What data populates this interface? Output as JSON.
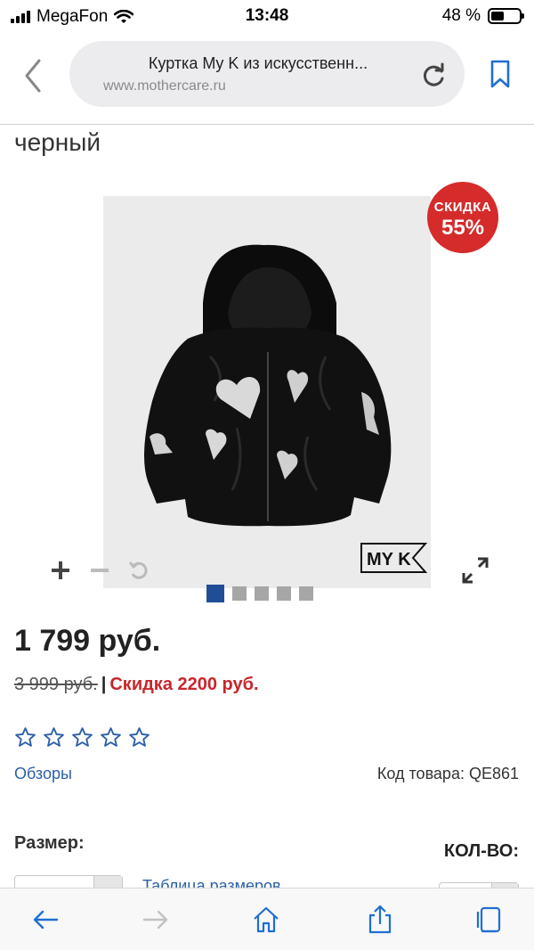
{
  "status_bar": {
    "carrier": "MegaFon",
    "time": "13:48",
    "battery_text": "48 %",
    "battery_level": 0.48
  },
  "browser": {
    "page_title": "Куртка My K из искусственн...",
    "domain": "www.mothercare.ru"
  },
  "product": {
    "color": "черный",
    "discount_badge": {
      "line1": "СКИДКА",
      "line2": "55%"
    },
    "brand_logo_text": "MY K",
    "price": "1 799 руб.",
    "old_price": "3 999 руб.",
    "separator": "|",
    "discount_text": "Скидка 2200 руб.",
    "rating_stars": 0,
    "rating_max": 5,
    "reviews_label": "Обзоры",
    "sku_label": "Код товара: QE861",
    "size_label": "Размер:",
    "size_table_link": "Таблица размеров",
    "qty_label": "КОЛ-ВО:"
  },
  "gallery": {
    "total_images": 5,
    "active_index": 0
  },
  "colors": {
    "accent_blue": "#2a5fa8",
    "sale_red": "#d52b2b",
    "active_dot": "#1f4e96"
  }
}
